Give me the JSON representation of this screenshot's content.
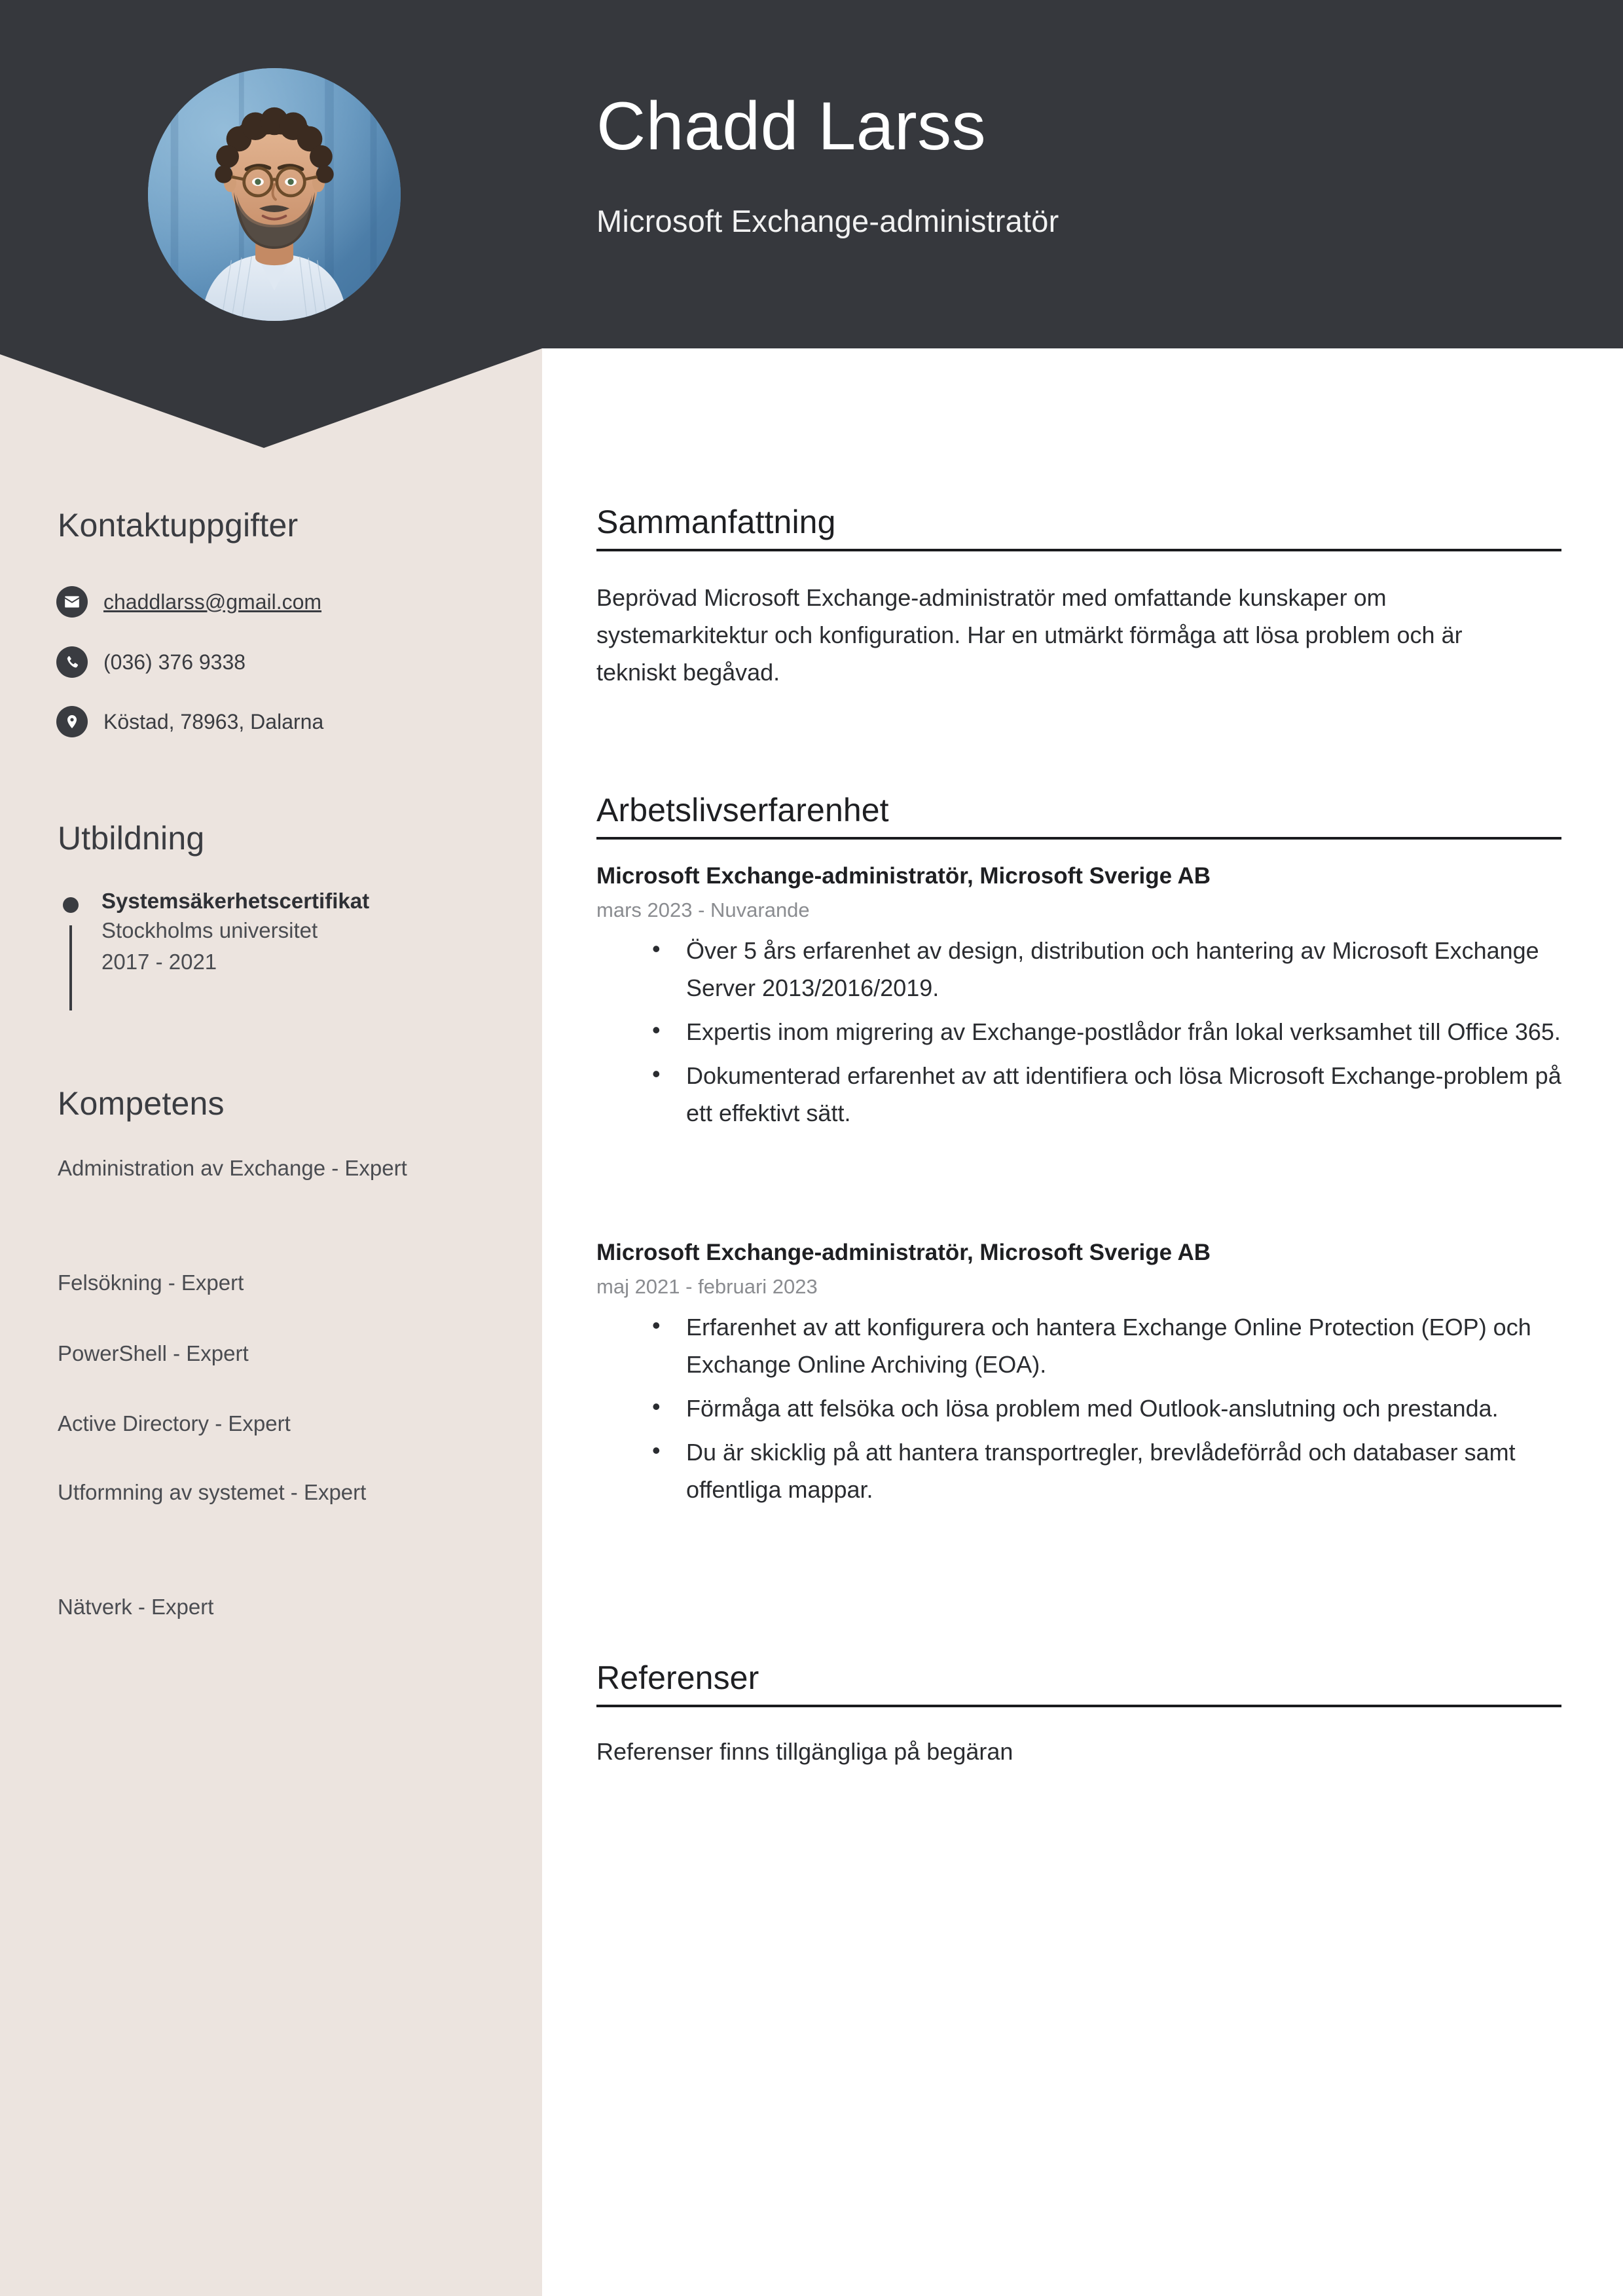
{
  "colors": {
    "header_dark": "#36383d",
    "sidebar_beige": "#ece4df",
    "page_white": "#ffffff",
    "text_dark": "#2a2c30",
    "date_grey": "#8a8c90"
  },
  "header": {
    "name": "Chadd Larss",
    "job_title": "Microsoft Exchange-administratör",
    "photo_alt": "portrait-photo"
  },
  "sidebar": {
    "contact": {
      "heading": "Kontaktuppgifter",
      "items": [
        {
          "icon": "envelope-icon",
          "value": "chaddlarss@gmail.com",
          "link": true
        },
        {
          "icon": "phone-icon",
          "value": "(036) 376 9338",
          "link": false
        },
        {
          "icon": "location-pin-icon",
          "value": "Köstad, 78963, Dalarna",
          "link": false
        }
      ]
    },
    "education": {
      "heading": "Utbildning",
      "entries": [
        {
          "degree": "Systemsäkerhetscertifikat",
          "school": "Stockholms universitet",
          "years": "2017 - 2021"
        }
      ]
    },
    "skills": {
      "heading": "Kompetens",
      "items": [
        "Administration av Exchange - Expert",
        "Felsökning - Expert",
        "PowerShell - Expert",
        "Active Directory - Expert",
        "Utformning av systemet - Expert",
        "Nätverk - Expert"
      ]
    }
  },
  "main": {
    "summary": {
      "heading": "Sammanfattning",
      "text": "Beprövad Microsoft Exchange-administratör med omfattande kunskaper om systemarkitektur och konfiguration. Har en utmärkt förmåga att lösa problem och är tekniskt begåvad."
    },
    "experience": {
      "heading": "Arbetslivserfarenhet",
      "jobs": [
        {
          "title": "Microsoft Exchange-administratör, Microsoft Sverige AB",
          "dates": "mars 2023 - Nuvarande",
          "bullets": [
            "Över 5 års erfarenhet av design, distribution och hantering av Microsoft Exchange Server 2013/2016/2019.",
            "Expertis inom migrering av Exchange-postlådor från lokal verksamhet till Office 365.",
            "Dokumenterad erfarenhet av att identifiera och lösa Microsoft Exchange-problem på ett effektivt sätt."
          ]
        },
        {
          "title": "Microsoft Exchange-administratör, Microsoft Sverige AB",
          "dates": "maj 2021 - februari 2023",
          "bullets": [
            "Erfarenhet av att konfigurera och hantera Exchange Online Protection (EOP) och Exchange Online Archiving (EOA).",
            "Förmåga att felsöka och lösa problem med Outlook-anslutning och prestanda.",
            "Du är skicklig på att hantera transportregler, brevlådeförråd och databaser samt offentliga mappar."
          ]
        }
      ]
    },
    "references": {
      "heading": "Referenser",
      "text": "Referenser finns tillgängliga på begäran"
    }
  }
}
